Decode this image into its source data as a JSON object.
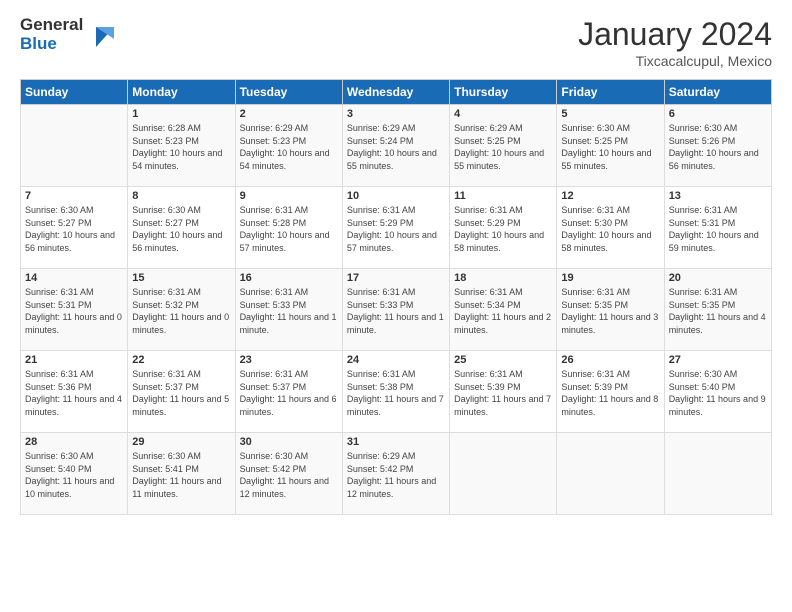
{
  "header": {
    "logo_general": "General",
    "logo_blue": "Blue",
    "month": "January 2024",
    "location": "Tixcacalcupul, Mexico"
  },
  "days_of_week": [
    "Sunday",
    "Monday",
    "Tuesday",
    "Wednesday",
    "Thursday",
    "Friday",
    "Saturday"
  ],
  "weeks": [
    [
      {
        "day": "",
        "sunrise": "",
        "sunset": "",
        "daylight": ""
      },
      {
        "day": "1",
        "sunrise": "Sunrise: 6:28 AM",
        "sunset": "Sunset: 5:23 PM",
        "daylight": "Daylight: 10 hours and 54 minutes."
      },
      {
        "day": "2",
        "sunrise": "Sunrise: 6:29 AM",
        "sunset": "Sunset: 5:23 PM",
        "daylight": "Daylight: 10 hours and 54 minutes."
      },
      {
        "day": "3",
        "sunrise": "Sunrise: 6:29 AM",
        "sunset": "Sunset: 5:24 PM",
        "daylight": "Daylight: 10 hours and 55 minutes."
      },
      {
        "day": "4",
        "sunrise": "Sunrise: 6:29 AM",
        "sunset": "Sunset: 5:25 PM",
        "daylight": "Daylight: 10 hours and 55 minutes."
      },
      {
        "day": "5",
        "sunrise": "Sunrise: 6:30 AM",
        "sunset": "Sunset: 5:25 PM",
        "daylight": "Daylight: 10 hours and 55 minutes."
      },
      {
        "day": "6",
        "sunrise": "Sunrise: 6:30 AM",
        "sunset": "Sunset: 5:26 PM",
        "daylight": "Daylight: 10 hours and 56 minutes."
      }
    ],
    [
      {
        "day": "7",
        "sunrise": "Sunrise: 6:30 AM",
        "sunset": "Sunset: 5:27 PM",
        "daylight": "Daylight: 10 hours and 56 minutes."
      },
      {
        "day": "8",
        "sunrise": "Sunrise: 6:30 AM",
        "sunset": "Sunset: 5:27 PM",
        "daylight": "Daylight: 10 hours and 56 minutes."
      },
      {
        "day": "9",
        "sunrise": "Sunrise: 6:31 AM",
        "sunset": "Sunset: 5:28 PM",
        "daylight": "Daylight: 10 hours and 57 minutes."
      },
      {
        "day": "10",
        "sunrise": "Sunrise: 6:31 AM",
        "sunset": "Sunset: 5:29 PM",
        "daylight": "Daylight: 10 hours and 57 minutes."
      },
      {
        "day": "11",
        "sunrise": "Sunrise: 6:31 AM",
        "sunset": "Sunset: 5:29 PM",
        "daylight": "Daylight: 10 hours and 58 minutes."
      },
      {
        "day": "12",
        "sunrise": "Sunrise: 6:31 AM",
        "sunset": "Sunset: 5:30 PM",
        "daylight": "Daylight: 10 hours and 58 minutes."
      },
      {
        "day": "13",
        "sunrise": "Sunrise: 6:31 AM",
        "sunset": "Sunset: 5:31 PM",
        "daylight": "Daylight: 10 hours and 59 minutes."
      }
    ],
    [
      {
        "day": "14",
        "sunrise": "Sunrise: 6:31 AM",
        "sunset": "Sunset: 5:31 PM",
        "daylight": "Daylight: 11 hours and 0 minutes."
      },
      {
        "day": "15",
        "sunrise": "Sunrise: 6:31 AM",
        "sunset": "Sunset: 5:32 PM",
        "daylight": "Daylight: 11 hours and 0 minutes."
      },
      {
        "day": "16",
        "sunrise": "Sunrise: 6:31 AM",
        "sunset": "Sunset: 5:33 PM",
        "daylight": "Daylight: 11 hours and 1 minute."
      },
      {
        "day": "17",
        "sunrise": "Sunrise: 6:31 AM",
        "sunset": "Sunset: 5:33 PM",
        "daylight": "Daylight: 11 hours and 1 minute."
      },
      {
        "day": "18",
        "sunrise": "Sunrise: 6:31 AM",
        "sunset": "Sunset: 5:34 PM",
        "daylight": "Daylight: 11 hours and 2 minutes."
      },
      {
        "day": "19",
        "sunrise": "Sunrise: 6:31 AM",
        "sunset": "Sunset: 5:35 PM",
        "daylight": "Daylight: 11 hours and 3 minutes."
      },
      {
        "day": "20",
        "sunrise": "Sunrise: 6:31 AM",
        "sunset": "Sunset: 5:35 PM",
        "daylight": "Daylight: 11 hours and 4 minutes."
      }
    ],
    [
      {
        "day": "21",
        "sunrise": "Sunrise: 6:31 AM",
        "sunset": "Sunset: 5:36 PM",
        "daylight": "Daylight: 11 hours and 4 minutes."
      },
      {
        "day": "22",
        "sunrise": "Sunrise: 6:31 AM",
        "sunset": "Sunset: 5:37 PM",
        "daylight": "Daylight: 11 hours and 5 minutes."
      },
      {
        "day": "23",
        "sunrise": "Sunrise: 6:31 AM",
        "sunset": "Sunset: 5:37 PM",
        "daylight": "Daylight: 11 hours and 6 minutes."
      },
      {
        "day": "24",
        "sunrise": "Sunrise: 6:31 AM",
        "sunset": "Sunset: 5:38 PM",
        "daylight": "Daylight: 11 hours and 7 minutes."
      },
      {
        "day": "25",
        "sunrise": "Sunrise: 6:31 AM",
        "sunset": "Sunset: 5:39 PM",
        "daylight": "Daylight: 11 hours and 7 minutes."
      },
      {
        "day": "26",
        "sunrise": "Sunrise: 6:31 AM",
        "sunset": "Sunset: 5:39 PM",
        "daylight": "Daylight: 11 hours and 8 minutes."
      },
      {
        "day": "27",
        "sunrise": "Sunrise: 6:30 AM",
        "sunset": "Sunset: 5:40 PM",
        "daylight": "Daylight: 11 hours and 9 minutes."
      }
    ],
    [
      {
        "day": "28",
        "sunrise": "Sunrise: 6:30 AM",
        "sunset": "Sunset: 5:40 PM",
        "daylight": "Daylight: 11 hours and 10 minutes."
      },
      {
        "day": "29",
        "sunrise": "Sunrise: 6:30 AM",
        "sunset": "Sunset: 5:41 PM",
        "daylight": "Daylight: 11 hours and 11 minutes."
      },
      {
        "day": "30",
        "sunrise": "Sunrise: 6:30 AM",
        "sunset": "Sunset: 5:42 PM",
        "daylight": "Daylight: 11 hours and 12 minutes."
      },
      {
        "day": "31",
        "sunrise": "Sunrise: 6:29 AM",
        "sunset": "Sunset: 5:42 PM",
        "daylight": "Daylight: 11 hours and 12 minutes."
      },
      {
        "day": "",
        "sunrise": "",
        "sunset": "",
        "daylight": ""
      },
      {
        "day": "",
        "sunrise": "",
        "sunset": "",
        "daylight": ""
      },
      {
        "day": "",
        "sunrise": "",
        "sunset": "",
        "daylight": ""
      }
    ]
  ]
}
